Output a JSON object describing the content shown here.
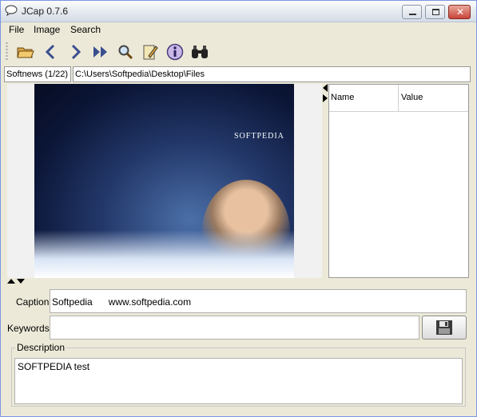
{
  "window": {
    "title": "JCap 0.7.6",
    "minimize_symbol": "",
    "maximize_symbol": "",
    "close_symbol": "✕"
  },
  "menu": {
    "items": [
      "File",
      "Image",
      "Search"
    ]
  },
  "toolbar": {
    "buttons": [
      {
        "icon": "open-folder-icon"
      },
      {
        "icon": "previous-icon"
      },
      {
        "icon": "next-icon"
      },
      {
        "icon": "last-icon"
      },
      {
        "icon": "search-icon"
      },
      {
        "icon": "edit-icon"
      },
      {
        "icon": "info-icon"
      },
      {
        "icon": "binoculars-icon"
      }
    ]
  },
  "location": {
    "collection_label": "Softnews (1/22)",
    "path": "C:\\Users\\Softpedia\\Desktop\\Files"
  },
  "image": {
    "logo_text": "SOFTPEDIA"
  },
  "properties": {
    "columns": [
      "Name",
      "Value"
    ]
  },
  "form": {
    "caption_label": "Caption:",
    "caption_value": "Softpedia      www.softpedia.com",
    "keywords_label": "Keywords:",
    "keywords_value": "",
    "description_legend": "Description",
    "description_value": "SOFTPEDIA test"
  },
  "colors": {
    "window_bg": "#ece9d8",
    "photo_dark": "#0b1536"
  }
}
